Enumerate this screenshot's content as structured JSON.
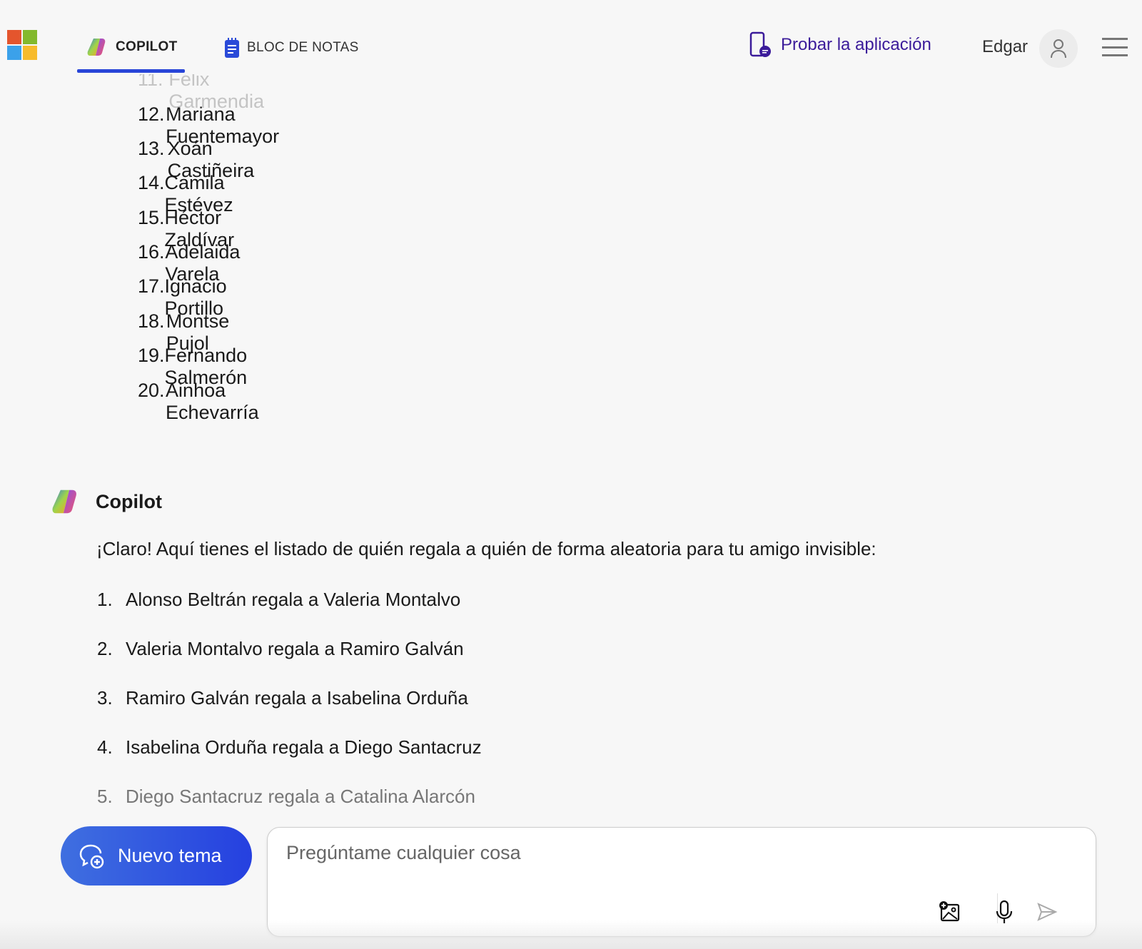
{
  "header": {
    "tabs": [
      {
        "label": "COPILOT",
        "icon": "copilot-logo-icon",
        "active": true
      },
      {
        "label": "BLOC DE NOTAS",
        "icon": "notebook-icon",
        "active": false
      }
    ],
    "try_app_label": "Probar la aplicación",
    "user_name": "Edgar",
    "accent_color": "#2845d8"
  },
  "participant_list": [
    {
      "num": "11.",
      "name": "Félix Garmendia"
    },
    {
      "num": "12.",
      "name": "Mariana Fuentemayor"
    },
    {
      "num": "13.",
      "name": "Xoán Castiñeira"
    },
    {
      "num": "14.",
      "name": "Camila Estévez"
    },
    {
      "num": "15.",
      "name": "Héctor Zaldívar"
    },
    {
      "num": "16.",
      "name": "Adelaida Varela"
    },
    {
      "num": "17.",
      "name": "Ignacio Portillo"
    },
    {
      "num": "18.",
      "name": "Montse Pujol"
    },
    {
      "num": "19.",
      "name": "Fernando Salmerón"
    },
    {
      "num": "20.",
      "name": "Ainhoa Echevarría"
    }
  ],
  "response": {
    "author": "Copilot",
    "intro": "¡Claro! Aquí tienes el listado de quién regala a quién de forma aleatoria para tu amigo invisible:",
    "items": [
      {
        "num": "1.",
        "text": "Alonso Beltrán regala a Valeria Montalvo"
      },
      {
        "num": "2.",
        "text": "Valeria Montalvo regala a Ramiro Galván"
      },
      {
        "num": "3.",
        "text": "Ramiro Galván regala a Isabelina Orduña"
      },
      {
        "num": "4.",
        "text": "Isabelina Orduña regala a Diego Santacruz"
      },
      {
        "num": "5.",
        "text": "Diego Santacruz regala a Catalina Alarcón"
      }
    ]
  },
  "composer": {
    "new_topic_label": "Nuevo tema",
    "placeholder": "Pregúntame cualquier cosa"
  }
}
